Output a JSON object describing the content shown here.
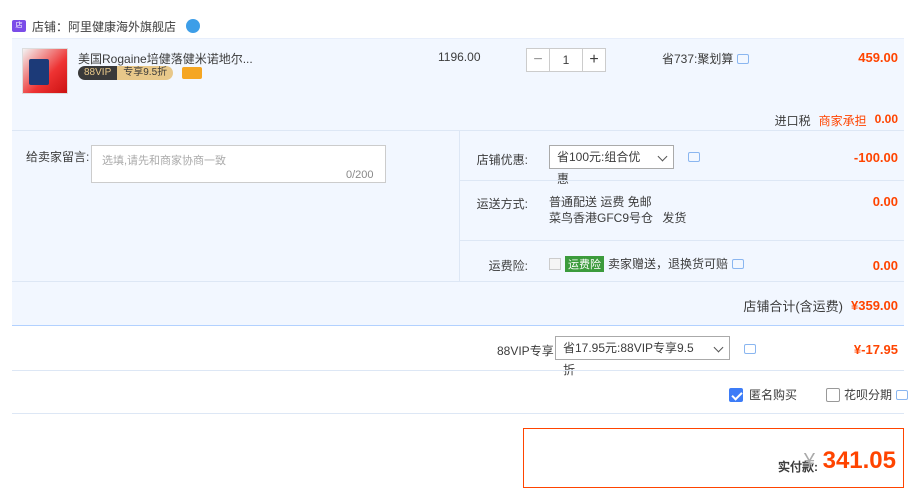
{
  "shop": {
    "label": "店铺：",
    "name": "阿里健康海外旗舰店"
  },
  "item": {
    "title": "美国Rogaine培健落健米诺地尔...",
    "vip_a": "88VIP",
    "vip_b": "专享9.5折",
    "unit_price": "1196.00",
    "quantity": "1",
    "promo": "省737:聚划算",
    "total": "459.00"
  },
  "tax": {
    "label": "进口税",
    "seller": "商家承担",
    "value": "0.00"
  },
  "message": {
    "label": "给卖家留言:",
    "placeholder": "选填,请先和商家协商一致",
    "count": "0/200"
  },
  "discount": {
    "label": "店铺优惠:",
    "selected": "省100元:组合优惠",
    "value": "-100.00"
  },
  "shipping": {
    "label": "运送方式:",
    "line1": "普通配送 运费 免邮",
    "line2": "菜鸟香港GFC9号仓",
    "line2b": "发货",
    "value": "0.00"
  },
  "insurance": {
    "label": "运费险:",
    "tag": "运费险",
    "text": "卖家赠送，退换货可赔",
    "value": "0.00"
  },
  "store_total": {
    "label": "店铺合计(含运费)",
    "value": "¥359.00"
  },
  "vip": {
    "label": "88VIP专享",
    "selected": "省17.95元:88VIP专享9.5折",
    "value": "¥-17.95"
  },
  "options": {
    "anonymous": "匿名购买",
    "huabei": "花呗分期"
  },
  "pay": {
    "label": "实付款:",
    "currency": "¥",
    "value": "341.05"
  },
  "colors": {
    "accent": "#ff4400",
    "panel": "#f2f7ff",
    "checkbox": "#3d7cf7"
  }
}
